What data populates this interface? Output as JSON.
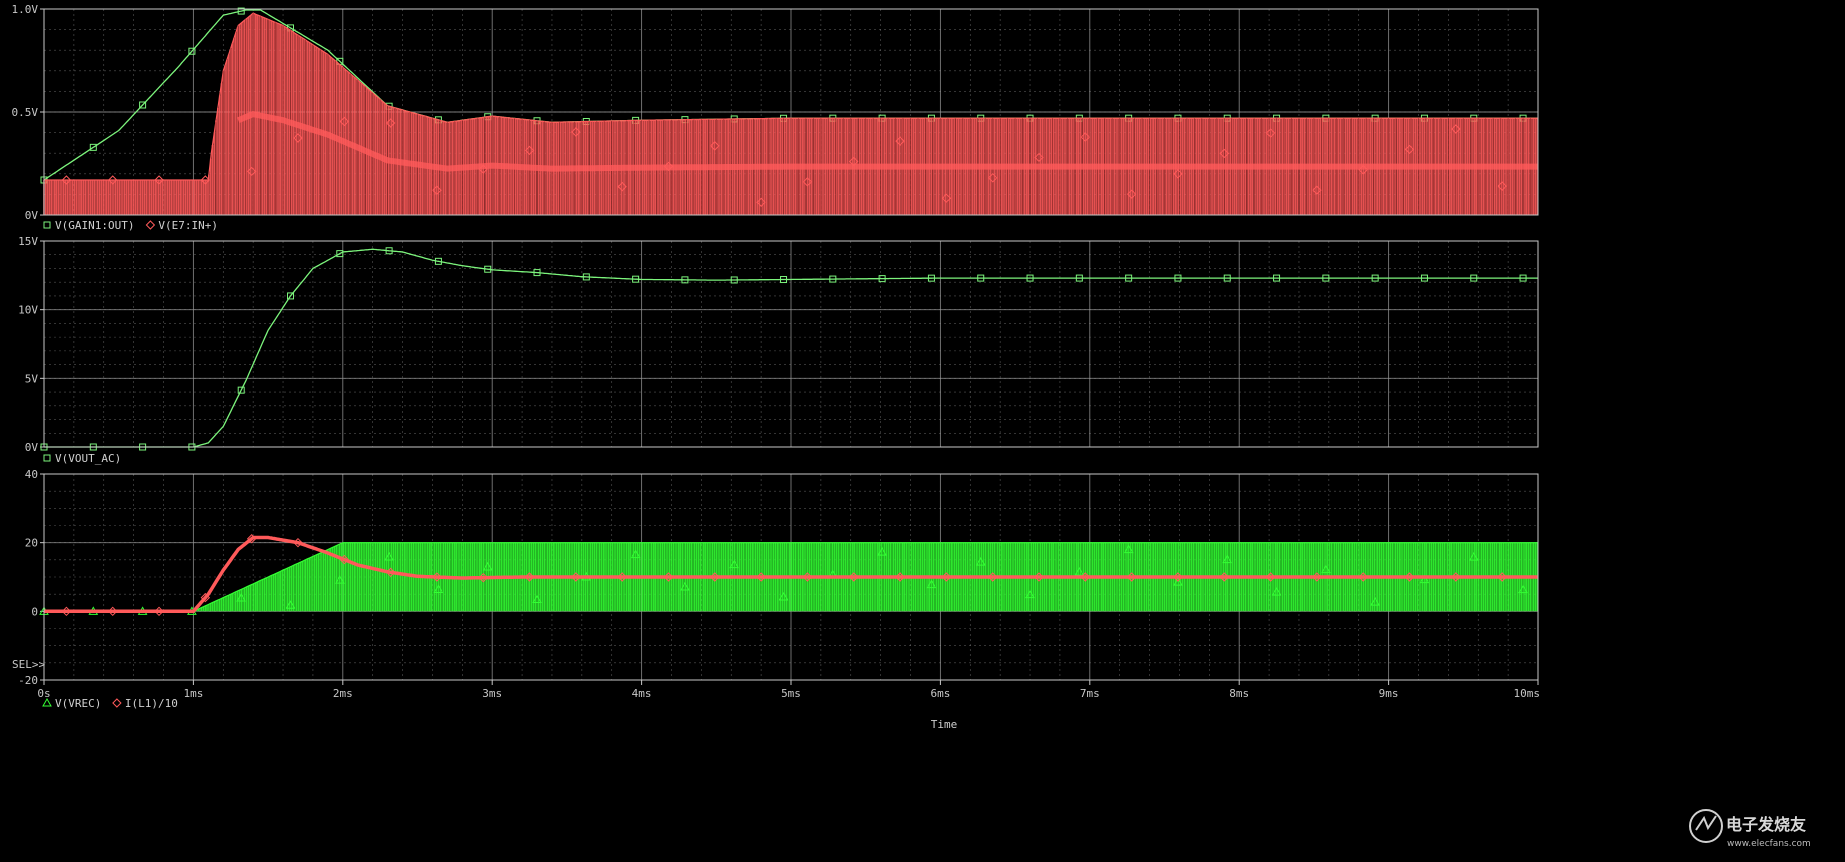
{
  "colors": {
    "background": "#000000",
    "grid": "#9a9a9a",
    "frame": "#c8c8c8",
    "text": "#d0d0d0",
    "trace_green": "#7cf47c",
    "fill_green": "#33ff33",
    "trace_red": "#ff5a5a"
  },
  "x_axis": {
    "label": "Time",
    "range": [
      0,
      10
    ],
    "unit": "ms",
    "ticks": [
      "0s",
      "1ms",
      "2ms",
      "3ms",
      "4ms",
      "5ms",
      "6ms",
      "7ms",
      "8ms",
      "9ms",
      "10ms"
    ]
  },
  "sel_marker": "SEL>>",
  "watermark": {
    "text": "电子发烧友",
    "sub": "www.elecfans.com",
    "icon": "elecfans-logo-icon"
  },
  "chart_data": [
    {
      "type": "line",
      "ylim": [
        0,
        1.0
      ],
      "yticks": [
        "1.0V",
        "0.5V",
        "0V"
      ],
      "legend": [
        {
          "marker": "square",
          "label": "V(GAIN1:OUT)"
        },
        {
          "marker": "diamond",
          "label": "V(E7:IN+)"
        }
      ],
      "series": [
        {
          "name": "V(GAIN1:OUT)",
          "color": "#7cf47c",
          "marker": "square",
          "x": [
            0,
            0.5,
            0.9,
            1.2,
            1.35,
            1.45,
            1.6,
            1.9,
            2.3,
            2.7,
            3.0,
            3.4,
            4.0,
            5.0,
            6.0,
            7.0,
            8.0,
            9.0,
            10.0
          ],
          "y": [
            0.17,
            0.41,
            0.72,
            0.97,
            0.995,
            0.995,
            0.93,
            0.8,
            0.53,
            0.45,
            0.48,
            0.45,
            0.46,
            0.47,
            0.47,
            0.47,
            0.47,
            0.47,
            0.47
          ]
        },
        {
          "name": "V(E7:IN+)",
          "color": "#ff5a5a",
          "marker": "diamond",
          "style": "switching_fill",
          "baseline": 0,
          "x": [
            0,
            1.1,
            1.12,
            1.2,
            1.3,
            1.4,
            1.6,
            1.9,
            2.3,
            2.7,
            3.0,
            3.4,
            4.0,
            5.0,
            6.0,
            7.0,
            8.0,
            9.0,
            10.0
          ],
          "y": [
            0.17,
            0.17,
            0.3,
            0.7,
            0.92,
            0.98,
            0.92,
            0.78,
            0.53,
            0.45,
            0.48,
            0.45,
            0.46,
            0.47,
            0.47,
            0.47,
            0.47,
            0.47,
            0.47
          ]
        }
      ]
    },
    {
      "type": "line",
      "ylim": [
        0,
        15
      ],
      "yticks": [
        "15V",
        "10V",
        "5V",
        "0V"
      ],
      "legend": [
        {
          "marker": "square",
          "label": "V(VOUT_AC)"
        }
      ],
      "series": [
        {
          "name": "V(VOUT_AC)",
          "color": "#7cf47c",
          "marker": "square",
          "x": [
            0,
            1.0,
            1.1,
            1.2,
            1.35,
            1.5,
            1.65,
            1.8,
            2.0,
            2.2,
            2.4,
            2.6,
            2.8,
            3.0,
            3.3,
            3.6,
            4.0,
            4.5,
            5.0,
            6.0,
            7.0,
            8.0,
            9.0,
            10.0
          ],
          "y": [
            0,
            0,
            0.3,
            1.5,
            4.8,
            8.5,
            11.0,
            13.0,
            14.2,
            14.4,
            14.2,
            13.6,
            13.2,
            12.9,
            12.7,
            12.4,
            12.2,
            12.15,
            12.2,
            12.3,
            12.3,
            12.3,
            12.3,
            12.3
          ]
        }
      ]
    },
    {
      "type": "line",
      "ylim": [
        -20,
        40
      ],
      "yticks": [
        "40",
        "20",
        "0",
        "-20"
      ],
      "legend": [
        {
          "marker": "triangle",
          "label": "V(VREC)"
        },
        {
          "marker": "diamond",
          "label": "I(L1)/10"
        }
      ],
      "series": [
        {
          "name": "V(VREC)",
          "color": "#33ff33",
          "marker": "triangle",
          "style": "switching_fill",
          "baseline": 0,
          "x": [
            0,
            1.0,
            2.0,
            10.0
          ],
          "y": [
            0,
            0,
            20,
            20
          ]
        },
        {
          "name": "I(L1)/10",
          "color": "#ff5a5a",
          "marker": "diamond",
          "x": [
            0,
            1.0,
            1.1,
            1.2,
            1.3,
            1.4,
            1.5,
            1.7,
            1.9,
            2.1,
            2.3,
            2.5,
            2.8,
            3.2,
            4.0,
            5.0,
            6.0,
            7.0,
            8.0,
            9.0,
            10.0
          ],
          "y": [
            0,
            0,
            5,
            12,
            18,
            21.5,
            21.5,
            20,
            17,
            13.5,
            11.5,
            10.2,
            9.7,
            10,
            10,
            10,
            10,
            10,
            10,
            10,
            10
          ]
        }
      ]
    }
  ]
}
